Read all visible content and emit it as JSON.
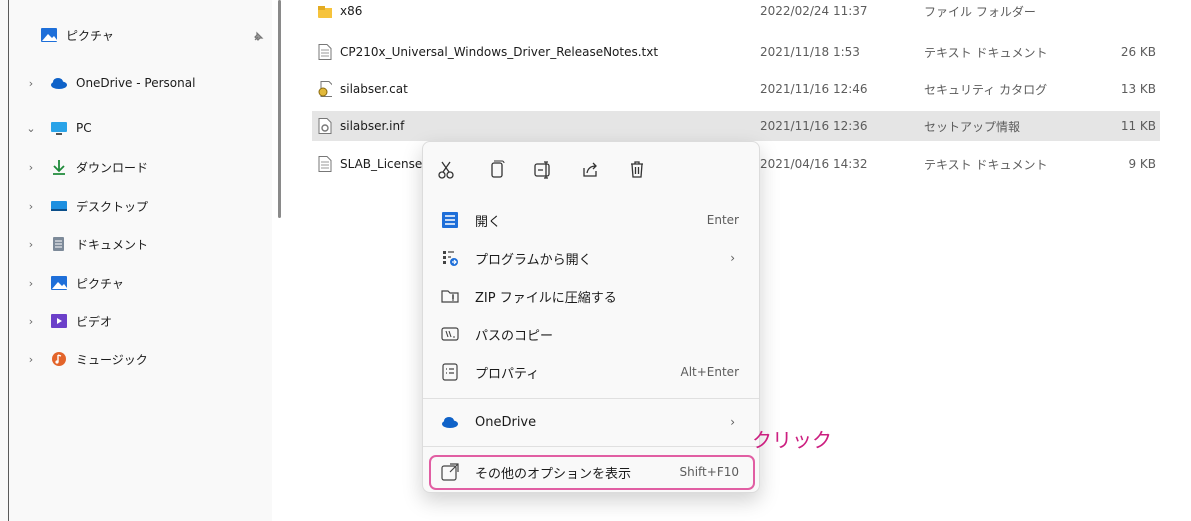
{
  "nav": {
    "items": [
      {
        "label": "ピクチャ",
        "icon": "pictures-icon",
        "pinned": true
      },
      {
        "label": "OneDrive - Personal",
        "icon": "onedrive-cloud-icon"
      },
      {
        "label": "PC",
        "icon": "pc-monitor-icon"
      },
      {
        "label": "ダウンロード",
        "icon": "download-icon"
      },
      {
        "label": "デスクトップ",
        "icon": "desktop-icon"
      },
      {
        "label": "ドキュメント",
        "icon": "documents-icon"
      },
      {
        "label": "ピクチャ",
        "icon": "pictures-icon"
      },
      {
        "label": "ビデオ",
        "icon": "videos-icon"
      },
      {
        "label": "ミュージック",
        "icon": "music-icon"
      }
    ]
  },
  "files": [
    {
      "name": "x86",
      "date": "2022/02/24 11:37",
      "type": "ファイル フォルダー",
      "size": "",
      "icon": "folder-icon"
    },
    {
      "name": "CP210x_Universal_Windows_Driver_ReleaseNotes.txt",
      "date": "2021/11/18 1:53",
      "type": "テキスト ドキュメント",
      "size": "26 KB",
      "icon": "text-file-icon"
    },
    {
      "name": "silabser.cat",
      "date": "2021/11/16 12:46",
      "type": "セキュリティ カタログ",
      "size": "13 KB",
      "icon": "catalog-file-icon"
    },
    {
      "name": "silabser.inf",
      "date": "2021/11/16 12:36",
      "type": "セットアップ情報",
      "size": "11 KB",
      "icon": "setup-file-icon",
      "selected": true
    },
    {
      "name": "SLAB_License",
      "date": "2021/04/16 14:32",
      "type": "テキスト ドキュメント",
      "size": "9 KB",
      "icon": "text-file-icon"
    }
  ],
  "context_menu": {
    "quick_actions": [
      "cut-icon",
      "copy-icon",
      "rename-icon",
      "share-icon",
      "delete-icon"
    ],
    "items": [
      {
        "label": "開く",
        "shortcut": "Enter",
        "icon": "open-icon"
      },
      {
        "label": "プログラムから開く",
        "submenu": "›",
        "icon": "open-with-icon"
      },
      {
        "label": "ZIP ファイルに圧縮する",
        "icon": "zip-icon"
      },
      {
        "label": "パスのコピー",
        "icon": "copy-path-icon"
      },
      {
        "label": "プロパティ",
        "shortcut": "Alt+Enter",
        "icon": "properties-icon"
      },
      {
        "label": "OneDrive",
        "submenu": "›",
        "icon": "onedrive-cloud-icon"
      },
      {
        "label": "その他のオプションを表示",
        "shortcut": "Shift+F10",
        "icon": "more-options-icon"
      }
    ]
  },
  "annotation": {
    "text": "クリック",
    "color": "#cc1f80"
  },
  "colors": {
    "selection": "#e5e5e5",
    "highlight_border": "#e15ea3",
    "accent": "#0067c0"
  }
}
